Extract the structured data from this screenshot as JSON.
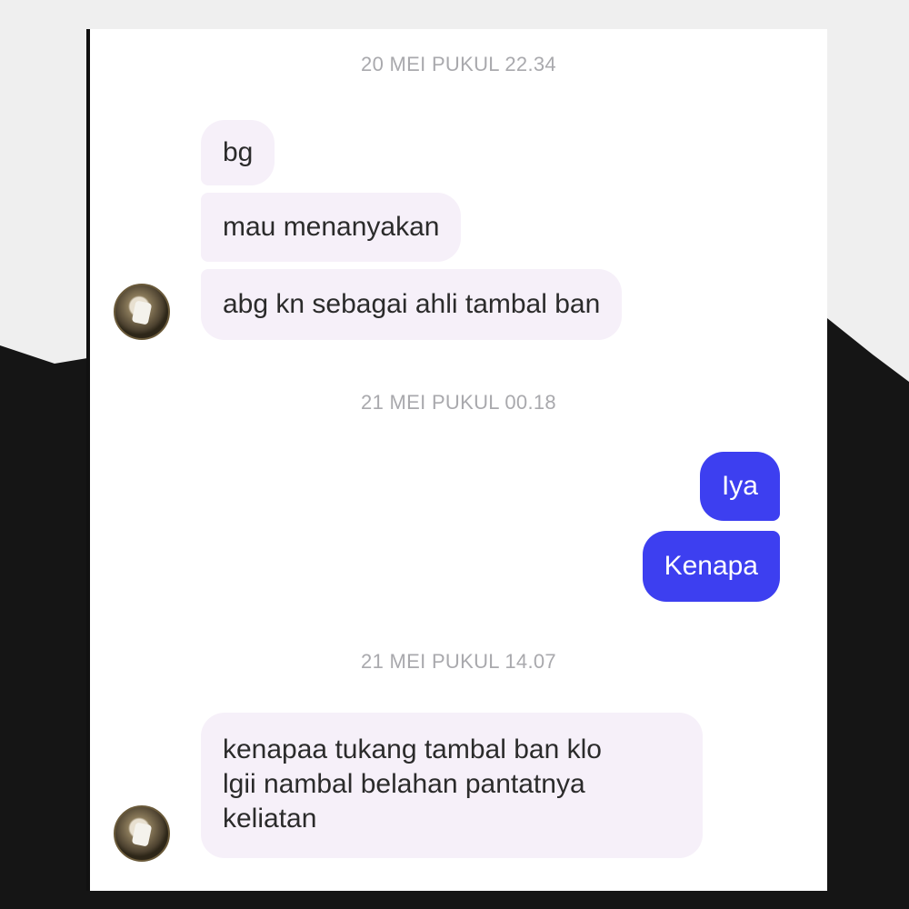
{
  "conversation": {
    "timestamps": [
      "20 MEI PUKUL 22.34",
      "21 MEI PUKUL 00.18",
      "21 MEI PUKUL 14.07"
    ],
    "group1": {
      "messages": [
        "bg",
        "mau menanyakan",
        "abg kn sebagai ahli tambal ban"
      ]
    },
    "group2": {
      "messages": [
        "Iya",
        "Kenapa"
      ]
    },
    "group3": {
      "lines": [
        "kenapaa tukang tambal ban klo",
        "lgii nambal belahan pantatnya",
        "keliatan"
      ]
    }
  },
  "colors": {
    "incoming_bubble": "#f6f0f9",
    "outgoing_bubble": "#3d3ff0",
    "timestamp_text": "#a9a9ad"
  },
  "icons": {
    "avatar": "contact-avatar-photo"
  }
}
